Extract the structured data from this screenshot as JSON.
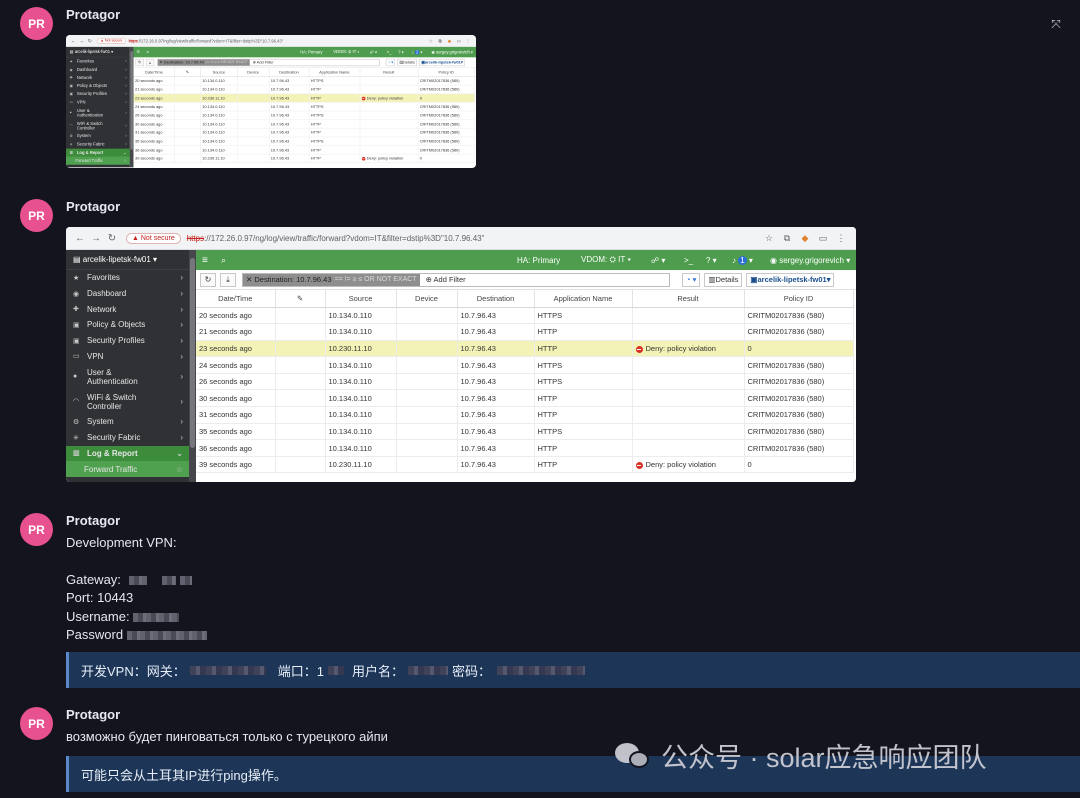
{
  "messages": [
    {
      "avatar": "PR",
      "author": "Protagor"
    },
    {
      "avatar": "PR",
      "author": "Protagor"
    },
    {
      "avatar": "PR",
      "author": "Protagor",
      "lines": {
        "title": "Development VPN:",
        "gateway": "Gateway:",
        "port": "Port: 10443",
        "username": "Username:",
        "password": "Password"
      },
      "quote": {
        "vpn": "开发VPN：网关：",
        "port": "端口：1",
        "user": "用户名：",
        "pass": "密码："
      }
    },
    {
      "avatar": "PR",
      "author": "Protagor",
      "text": "возможно будет пинговаться только с турецкого айпи",
      "quote": "可能只会从土耳其IP进行ping操作。"
    }
  ],
  "close_icon": "collapse-icon",
  "browser": {
    "not_secure": "Not secure",
    "url_https": "https",
    "url_rest": "://172.26.0.97/ng/log/view/traffic/forward?vdom=IT&filter=dstip%3D\"10.7.96.43\""
  },
  "fortigate": {
    "device": "arcelik-lipetsk-fw01",
    "ha": "HA: Primary",
    "vdom": "VDOM:",
    "vdom_value": "IT",
    "notif_count": "1",
    "user": "sergey.grigorevich",
    "filter_chip": "Destination: 10.7.96.43",
    "filter_ops": "== != ≥ ≤ OR NOT EXACT",
    "add_filter": "Add Filter",
    "details": "Details",
    "device_select": "arcelik-lipetsk-fw01",
    "sidebar": [
      {
        "label": "Favorites",
        "icon": "★"
      },
      {
        "label": "Dashboard",
        "icon": "◉"
      },
      {
        "label": "Network",
        "icon": "✚"
      },
      {
        "label": "Policy & Objects",
        "icon": "▣"
      },
      {
        "label": "Security Profiles",
        "icon": "▣"
      },
      {
        "label": "VPN",
        "icon": "▭"
      },
      {
        "label": "User & Authentication",
        "icon": "●"
      },
      {
        "label": "WiFi & Switch Controller",
        "icon": "◠"
      },
      {
        "label": "System",
        "icon": "⚙"
      },
      {
        "label": "Security Fabric",
        "icon": "✳"
      },
      {
        "label": "Log & Report",
        "icon": "▥"
      },
      {
        "label": "Forward Traffic",
        "icon": "☆"
      }
    ],
    "columns": [
      "Date/Time",
      "",
      "Source",
      "Device",
      "Destination",
      "Application Name",
      "Result",
      "Policy ID"
    ],
    "rows": [
      {
        "time": "20 seconds ago",
        "src": "10.134.0.110",
        "dst": "10.7.96.43",
        "app": "HTTPS",
        "result": "",
        "policy": "CRITM02017836 (580)"
      },
      {
        "time": "21 seconds ago",
        "src": "10.134.0.110",
        "dst": "10.7.96.43",
        "app": "HTTP",
        "result": "",
        "policy": "CRITM02017836 (580)"
      },
      {
        "time": "23 seconds ago",
        "src": "10.230.11.10",
        "dst": "10.7.96.43",
        "app": "HTTP",
        "result": "Deny: policy violation",
        "policy": "0"
      },
      {
        "time": "24 seconds ago",
        "src": "10.134.0.110",
        "dst": "10.7.96.43",
        "app": "HTTPS",
        "result": "",
        "policy": "CRITM02017836 (580)"
      },
      {
        "time": "26 seconds ago",
        "src": "10.134.0.110",
        "dst": "10.7.96.43",
        "app": "HTTPS",
        "result": "",
        "policy": "CRITM02017836 (580)"
      },
      {
        "time": "30 seconds ago",
        "src": "10.134.0.110",
        "dst": "10.7.96.43",
        "app": "HTTP",
        "result": "",
        "policy": "CRITM02017836 (580)"
      },
      {
        "time": "31 seconds ago",
        "src": "10.134.0.110",
        "dst": "10.7.96.43",
        "app": "HTTP",
        "result": "",
        "policy": "CRITM02017836 (580)"
      },
      {
        "time": "35 seconds ago",
        "src": "10.134.0.110",
        "dst": "10.7.96.43",
        "app": "HTTPS",
        "result": "",
        "policy": "CRITM02017836 (580)"
      },
      {
        "time": "36 seconds ago",
        "src": "10.134.0.110",
        "dst": "10.7.96.43",
        "app": "HTTP",
        "result": "",
        "policy": "CRITM02017836 (580)"
      },
      {
        "time": "39 seconds ago",
        "src": "10.230.11.10",
        "dst": "10.7.96.43",
        "app": "HTTP",
        "result": "Deny: policy violation",
        "policy": "0"
      }
    ]
  },
  "watermark": "公众号 · solar应急响应团队"
}
